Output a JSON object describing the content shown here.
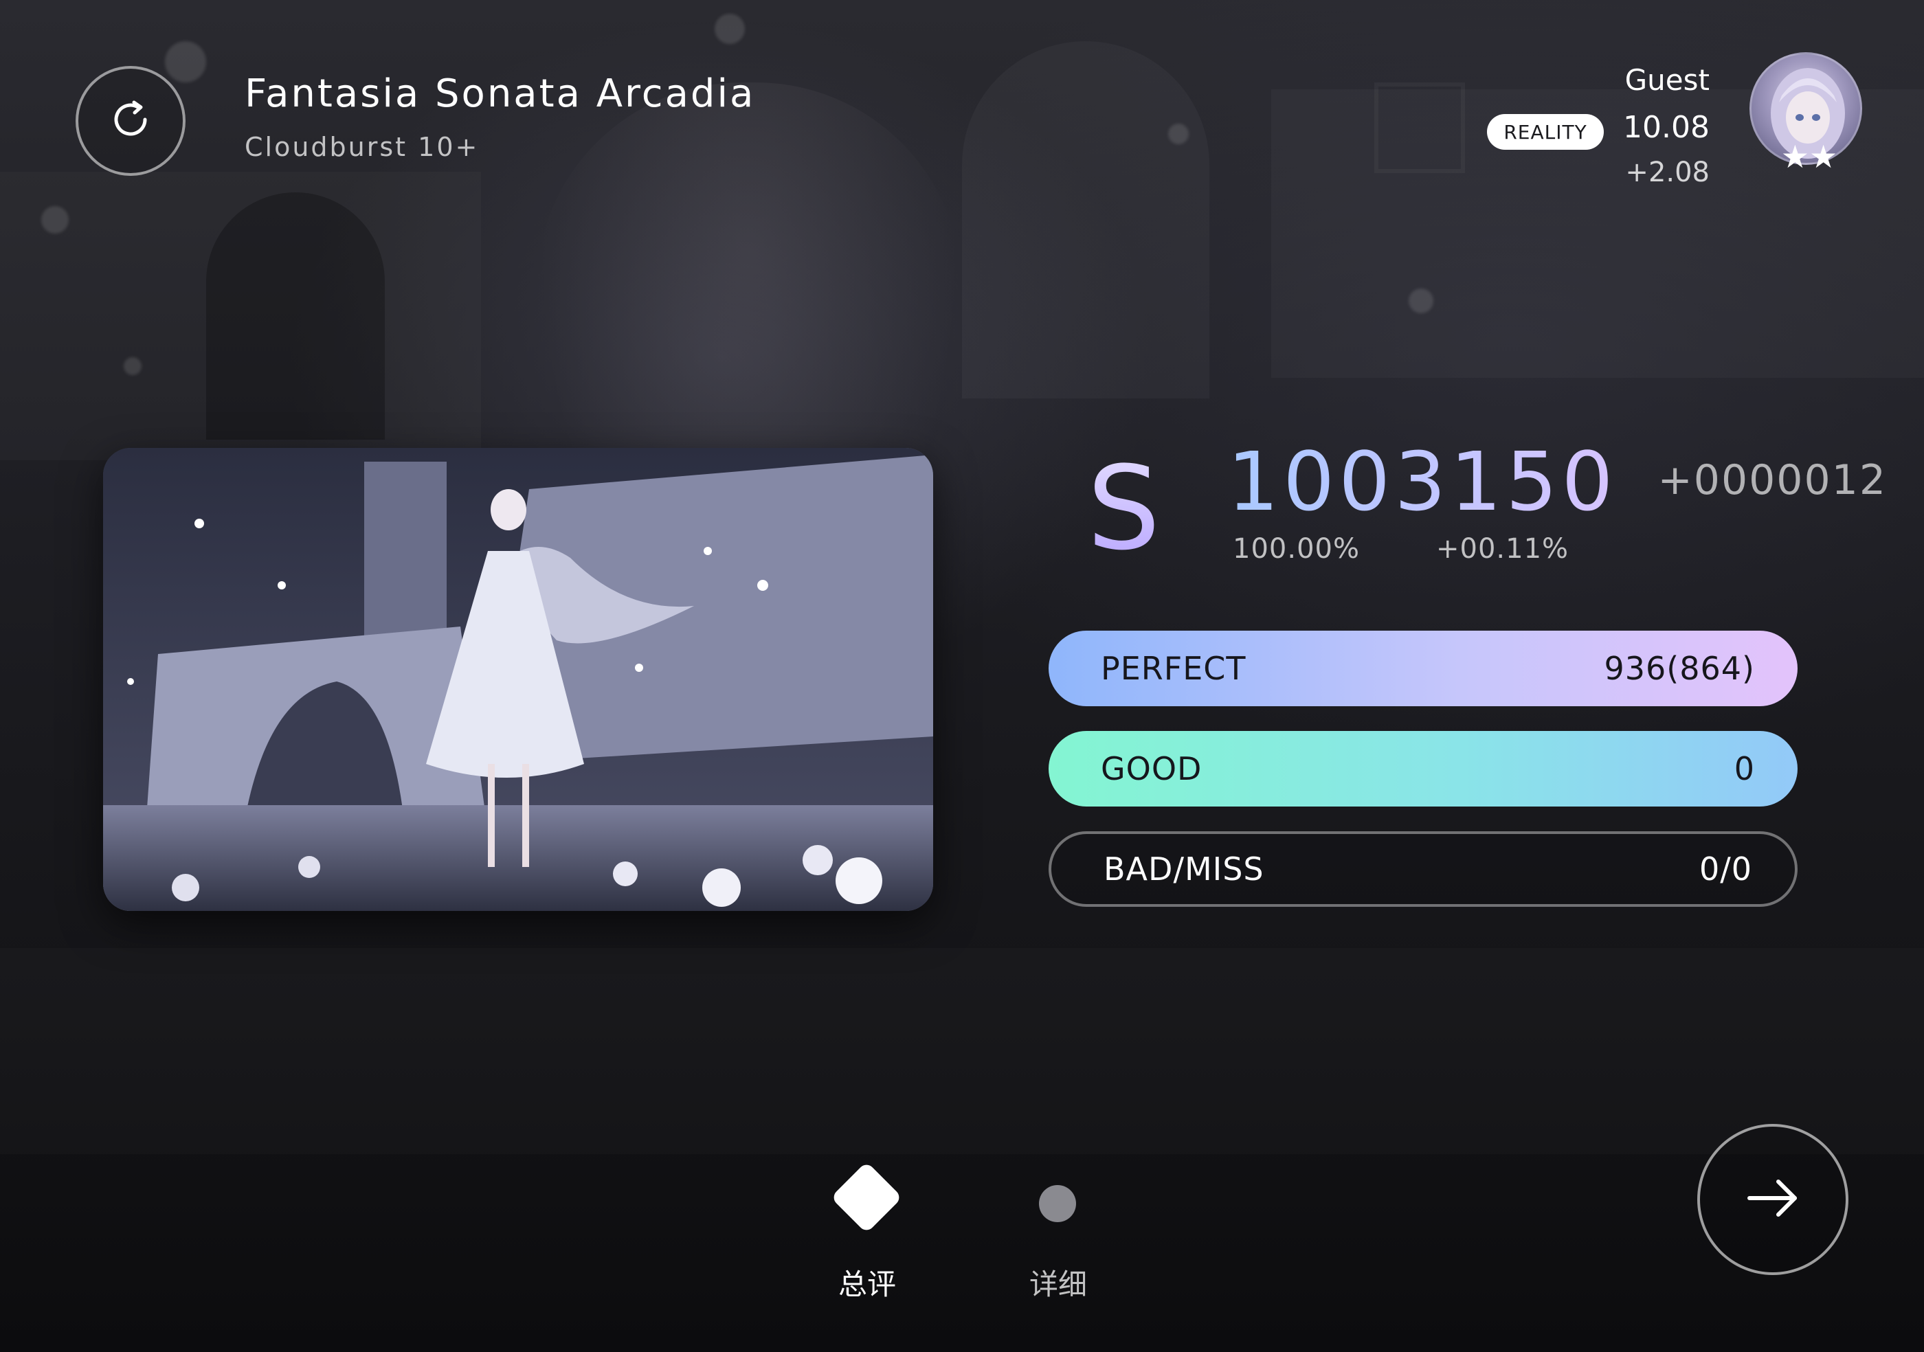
{
  "song": {
    "title": "Fantasia Sonata Arcadia",
    "difficulty": "Cloudburst 10+"
  },
  "player": {
    "name": "Guest",
    "badge": "REALITY",
    "rks": "10.08",
    "rks_delta": "+2.08",
    "stars": "★★"
  },
  "result": {
    "grade": "S",
    "score": "1003150",
    "score_delta": "+0000012",
    "accuracy": "100.00%",
    "accuracy_delta": "+00.11%"
  },
  "judgements": {
    "perfect_label": "PERFECT",
    "perfect_value": "936(864)",
    "good_label": "GOOD",
    "good_value": "0",
    "badmiss_label": "BAD/MISS",
    "badmiss_value": "0/0"
  },
  "tabs": {
    "summary_label": "总评",
    "detail_label": "详细"
  },
  "icons": {
    "retry": "retry-icon",
    "next": "arrow-right-icon",
    "summary_tab": "diamond-icon",
    "detail_tab": "dot-icon"
  },
  "colors": {
    "perfect_start": "#8fb6fb",
    "perfect_end": "#e3c3fb",
    "good_start": "#84f5d2",
    "good_end": "#93c9f8",
    "score_start": "#a9c8ff",
    "score_end": "#d7c4ff"
  }
}
